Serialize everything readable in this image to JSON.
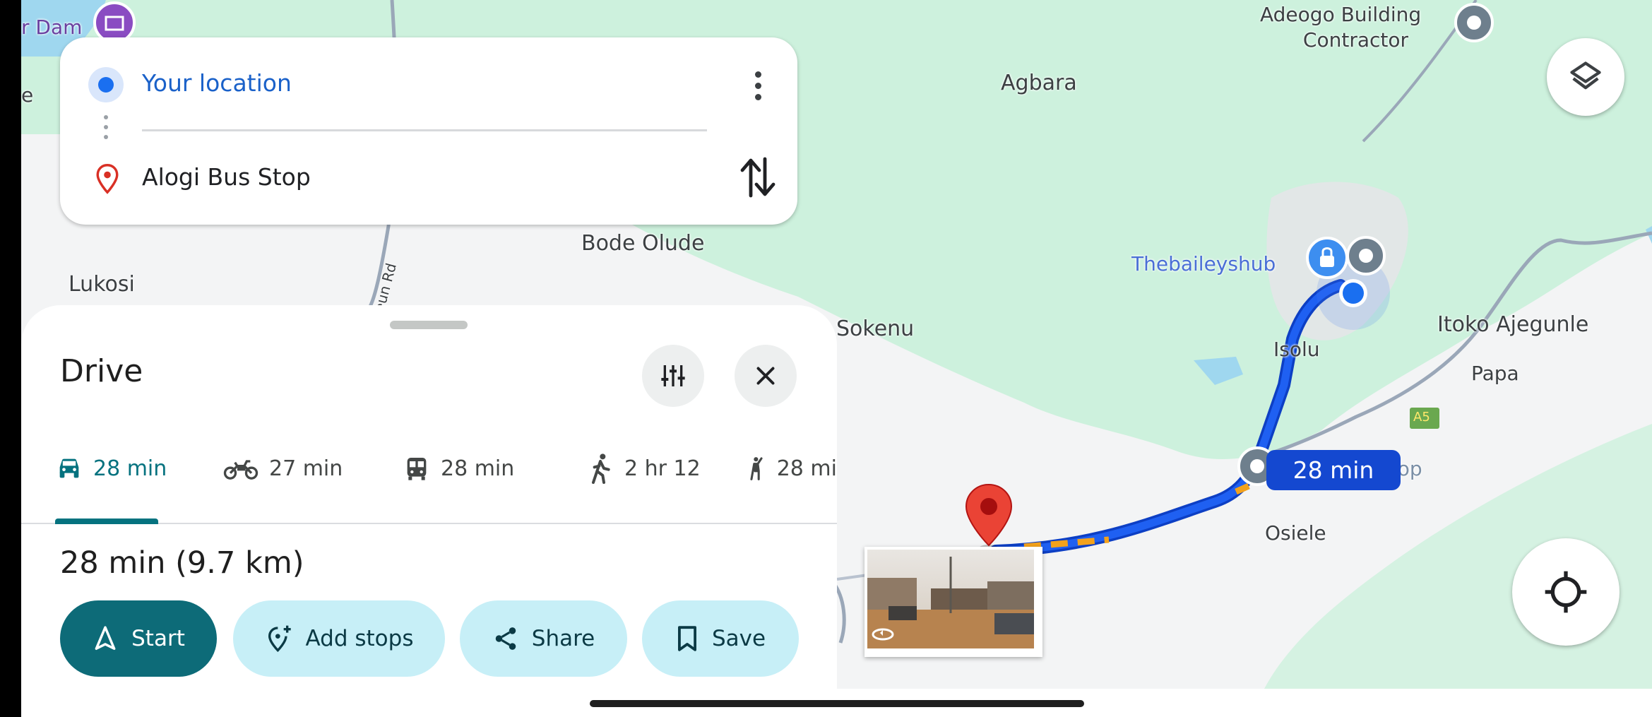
{
  "colors": {
    "map_green": "#cdf1dd",
    "map_gray": "#f3f4f5",
    "route_blue": "#1448d0",
    "accent_teal": "#05727f",
    "pill_bg": "#c7eff7",
    "start_bg": "#0d6b78"
  },
  "map": {
    "labels": {
      "dam": "r Dam",
      "edge_e": "e",
      "agbara": "Agbara",
      "adeogo_1": "Adeogo Building",
      "adeogo_2": "Contractor",
      "bode_olude": "Bode Olude",
      "lukosi": "Lukosi",
      "road": "eun Rd",
      "sokenu": "Sokenu",
      "thebaileyshub": "Thebaileyshub",
      "isolu": "Isolu",
      "itoko": "Itoko Ajegunle",
      "papa": "Papa",
      "stop": "Stop",
      "osiele": "Osiele",
      "a5": "A5"
    },
    "route_time": "28 min",
    "icons": {
      "layers": "layers-icon",
      "locate": "my-location-icon",
      "pin": "destination-pin-icon",
      "street_view": "street-view-icon"
    }
  },
  "directions": {
    "origin": "Your location",
    "destination": "Alogi Bus Stop",
    "icons": {
      "origin": "origin-dot-icon",
      "destination": "destination-pin-icon",
      "more": "more-vert-icon",
      "swap": "swap-icon"
    }
  },
  "sheet": {
    "title": "Drive",
    "tabs": [
      {
        "mode": "car",
        "label": "28 min",
        "icon": "car-icon",
        "active": true
      },
      {
        "mode": "motorcycle",
        "label": "27 min",
        "icon": "motorcycle-icon"
      },
      {
        "mode": "transit",
        "label": "28 min",
        "icon": "transit-icon"
      },
      {
        "mode": "walk",
        "label": "2 hr 12",
        "icon": "walk-icon"
      },
      {
        "mode": "ride",
        "label": "28 mi",
        "icon": "ride-icon"
      }
    ],
    "summary": "28 min (9.7 km)",
    "actions": {
      "start": "Start",
      "add_stops": "Add stops",
      "share": "Share",
      "save": "Save"
    }
  }
}
